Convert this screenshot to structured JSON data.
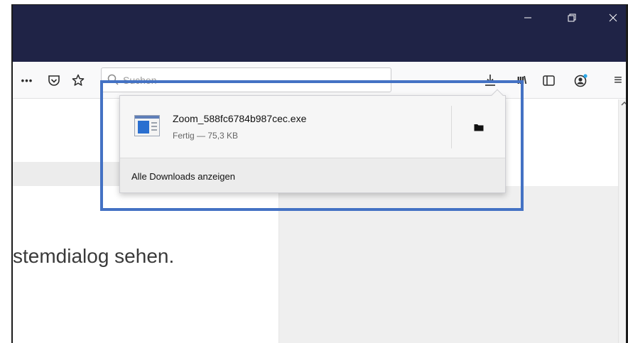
{
  "window": {
    "controls": {
      "minimize_icon": "minimize-icon",
      "maximize_icon": "restore-icon",
      "close_icon": "close-icon"
    }
  },
  "toolbar": {
    "more_label": "•••",
    "pocket_icon": "pocket-icon",
    "star_icon": "star-icon",
    "search_placeholder": "Suchen",
    "download_icon": "download-icon",
    "library_label": "III\\",
    "sidebar_icon": "sidebar-icon",
    "account_icon": "account-icon",
    "menu_label": "≡"
  },
  "downloads_panel": {
    "item": {
      "file_name": "Zoom_588fc6784b987cec.exe",
      "status": "Fertig — 75,3 KB"
    },
    "show_all_label": "Alle Downloads anzeigen"
  },
  "page": {
    "text": "stemdialog sehen."
  },
  "colors": {
    "titlebar": "#1f2346",
    "highlight": "#4472c4",
    "toolbar": "#f9f9fa"
  }
}
